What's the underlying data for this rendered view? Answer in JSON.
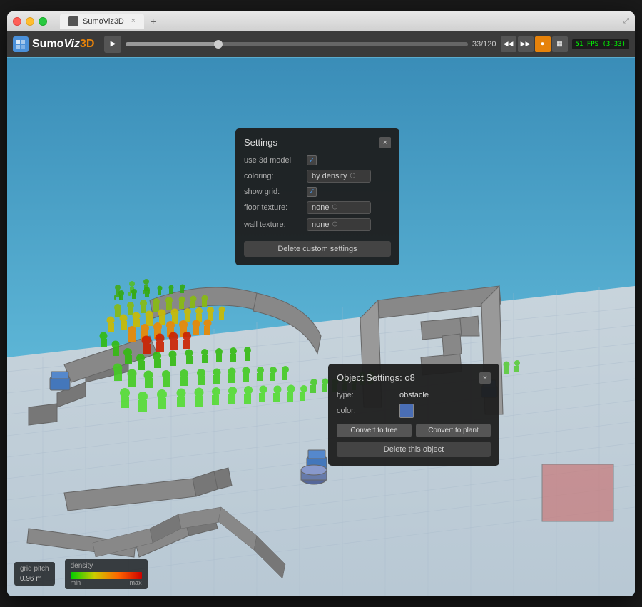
{
  "browser": {
    "title": "SumoViz3D",
    "tab_close": "×",
    "new_tab": "+"
  },
  "toolbar": {
    "logo_text": "SumoViz",
    "play_icon": "▶",
    "frame_current": "33",
    "frame_total": "120",
    "frame_display": "33/120",
    "fps_text": "51 FPS (3-33)",
    "nav_back_fast": "◀◀",
    "nav_forward_fast": "▶▶",
    "record_icon": "⏺",
    "camera_icon": "📷"
  },
  "settings_panel": {
    "title": "Settings",
    "close": "×",
    "use_3d_model_label": "use 3d model",
    "use_3d_model_checked": true,
    "coloring_label": "coloring:",
    "coloring_value": "by density",
    "show_grid_label": "show grid:",
    "show_grid_checked": true,
    "floor_texture_label": "floor texture:",
    "floor_texture_value": "none",
    "wall_texture_label": "wall texture:",
    "wall_texture_value": "none",
    "delete_btn": "Delete custom settings"
  },
  "object_panel": {
    "title": "Object Settings: o8",
    "close": "×",
    "type_label": "type:",
    "type_value": "obstacle",
    "color_label": "color:",
    "color_hex": "#4a6eb5",
    "convert_tree_btn": "Convert to tree",
    "convert_plant_btn": "Convert to plant",
    "delete_btn": "Delete this object"
  },
  "legend": {
    "grid_pitch_label": "grid pitch",
    "grid_pitch_value": "0.96 m",
    "density_label": "density",
    "density_min": "min",
    "density_max": "max"
  }
}
